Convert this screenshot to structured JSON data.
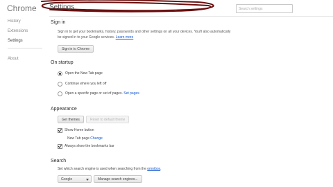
{
  "app": {
    "title": "Chrome"
  },
  "sidebar": {
    "items": [
      {
        "label": "History"
      },
      {
        "label": "Extensions"
      },
      {
        "label": "Settings"
      },
      {
        "label": "About"
      }
    ]
  },
  "header": {
    "title": "Settings",
    "search_placeholder": "Search settings"
  },
  "signin": {
    "title": "Sign in",
    "text_line1": "Sign in to get your bookmarks, history, passwords and other settings on all your devices. You'll also automatically",
    "text_line2": "be signed in to your Google services.",
    "learn_more": "Learn more",
    "button": "Sign in to Chrome"
  },
  "startup": {
    "title": "On startup",
    "options": [
      {
        "label": "Open the New Tab page",
        "selected": true
      },
      {
        "label": "Continue where you left off",
        "selected": false
      },
      {
        "label": "Open a specific page or set of pages.",
        "selected": false
      }
    ],
    "set_pages": "Set pages"
  },
  "appearance": {
    "title": "Appearance",
    "get_themes": "Get themes",
    "reset_theme": "Reset to default theme",
    "show_home_button": "Show Home button",
    "home_page_text": "New Tab page",
    "home_page_change": "Change",
    "show_bookmarks_bar": "Always show the bookmarks bar"
  },
  "search": {
    "title": "Search",
    "description": "Set which search engine is used when searching from the",
    "omnibox": "omnibox",
    "period": ".",
    "engine": "Google",
    "manage_button": "Manage search engines..."
  }
}
